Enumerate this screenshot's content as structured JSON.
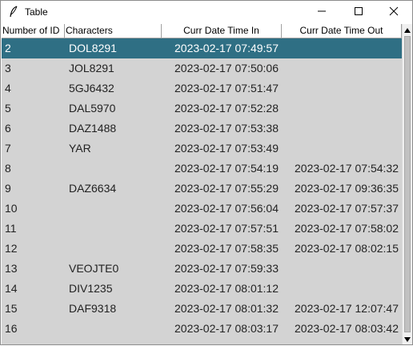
{
  "window": {
    "title": "Table"
  },
  "table": {
    "columns": [
      "Number of ID",
      "Characters",
      "Curr Date Time In",
      "Curr Date Time Out"
    ],
    "rows": [
      {
        "id": "2",
        "chars": "DOL8291",
        "time_in": "2023-02-17 07:49:57",
        "time_out": ""
      },
      {
        "id": "3",
        "chars": "JOL8291",
        "time_in": "2023-02-17 07:50:06",
        "time_out": ""
      },
      {
        "id": "4",
        "chars": "5GJ6432",
        "time_in": "2023-02-17 07:51:47",
        "time_out": ""
      },
      {
        "id": "5",
        "chars": "DAL5970",
        "time_in": "2023-02-17 07:52:28",
        "time_out": ""
      },
      {
        "id": "6",
        "chars": "DAZ1488",
        "time_in": "2023-02-17 07:53:38",
        "time_out": ""
      },
      {
        "id": "7",
        "chars": "YAR",
        "time_in": "2023-02-17 07:53:49",
        "time_out": ""
      },
      {
        "id": "8",
        "chars": "",
        "time_in": "2023-02-17 07:54:19",
        "time_out": "2023-02-17 07:54:32"
      },
      {
        "id": "9",
        "chars": "DAZ6634",
        "time_in": "2023-02-17 07:55:29",
        "time_out": "2023-02-17 09:36:35"
      },
      {
        "id": "10",
        "chars": "",
        "time_in": "2023-02-17 07:56:04",
        "time_out": "2023-02-17 07:57:37"
      },
      {
        "id": "11",
        "chars": "",
        "time_in": "2023-02-17 07:57:51",
        "time_out": "2023-02-17 07:58:02"
      },
      {
        "id": "12",
        "chars": "",
        "time_in": "2023-02-17 07:58:35",
        "time_out": "2023-02-17 08:02:15"
      },
      {
        "id": "13",
        "chars": "VEOJTE0",
        "time_in": "2023-02-17 07:59:33",
        "time_out": ""
      },
      {
        "id": "14",
        "chars": "DIV1235",
        "time_in": "2023-02-17 08:01:12",
        "time_out": ""
      },
      {
        "id": "15",
        "chars": "DAF9318",
        "time_in": "2023-02-17 08:01:32",
        "time_out": "2023-02-17 12:07:47"
      },
      {
        "id": "16",
        "chars": "",
        "time_in": "2023-02-17 08:03:17",
        "time_out": "2023-02-17 08:03:42"
      }
    ],
    "selected_row_index": 0
  },
  "colors": {
    "selected_row": "#2f6f84",
    "table_background": "#d3d3d3"
  },
  "icons": {
    "app": "feather-icon",
    "minimize": "minimize-icon",
    "maximize": "maximize-icon",
    "close": "close-icon"
  }
}
